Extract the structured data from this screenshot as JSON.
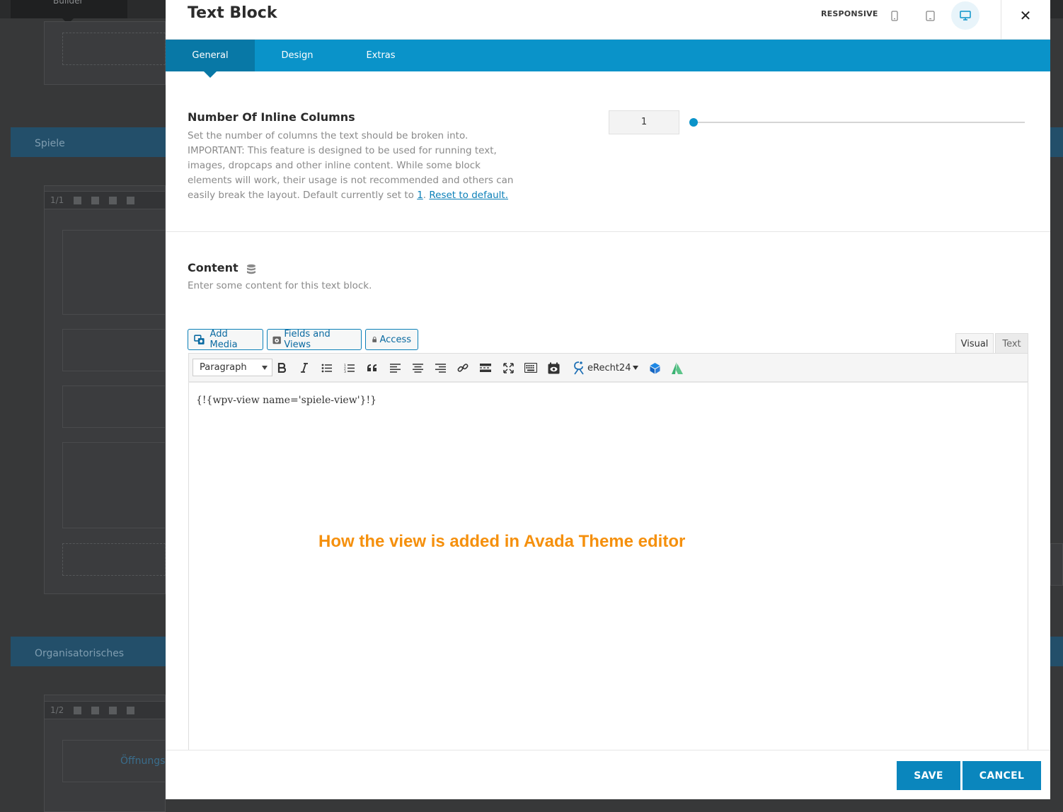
{
  "background": {
    "builder_label": "Builder",
    "sections": [
      {
        "label": "Spiele"
      },
      {
        "label": "Organisatorisches"
      }
    ],
    "column_bars": [
      {
        "size": "1/1"
      },
      {
        "size": "1/2"
      }
    ],
    "link_text": "Öffnungs"
  },
  "modal": {
    "title": "Text Block",
    "responsive_label": "RESPONSIVE",
    "devices": [
      {
        "icon": "mobile-icon",
        "active": false
      },
      {
        "icon": "tablet-icon",
        "active": false
      },
      {
        "icon": "desktop-icon",
        "active": true
      }
    ],
    "close_label": "✕",
    "tabs": [
      {
        "label": "General",
        "active": true
      },
      {
        "label": "Design",
        "active": false
      },
      {
        "label": "Extras",
        "active": false
      }
    ]
  },
  "inline_columns": {
    "title": "Number Of Inline Columns",
    "description": "Set the number of columns the text should be broken into. IMPORTANT: This feature is designed to be used for running text, images, dropcaps and other inline content. While some block elements will work, their usage is not recommended and others can easily break the layout. Default currently set to",
    "default_value": "1",
    "period": ".",
    "reset_label": "Reset to default.",
    "value": "1",
    "slider_fraction": 0.0
  },
  "content": {
    "title": "Content",
    "description": "Enter some content for this text block.",
    "media_buttons": [
      {
        "label": "Add Media",
        "icon": "add-media-icon"
      },
      {
        "label": "Fields and Views",
        "icon": "fields-views-icon"
      },
      {
        "label": "Access",
        "icon": "lock-icon"
      }
    ],
    "editor_tabs": {
      "visual": "Visual",
      "text": "Text"
    },
    "format_select": "Paragraph",
    "erecht_label": "eRecht24",
    "editor_text": "{!{wpv-view name='spiele-view'}!}"
  },
  "annotation": "How the view is added in Avada Theme editor",
  "footer": {
    "save_label": "SAVE",
    "cancel_label": "CANCEL"
  },
  "colors": {
    "accent": "#0a93c9",
    "tab_active": "#0878a6",
    "annotation": "#f5900d",
    "button": "#0a86bd"
  }
}
